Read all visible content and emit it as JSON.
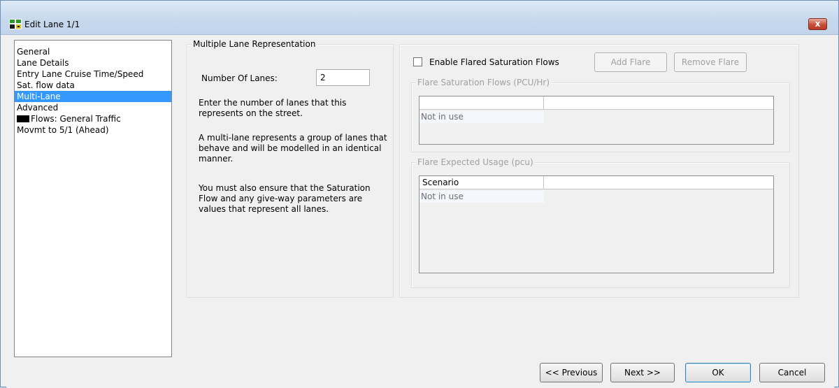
{
  "window": {
    "title": "Edit Lane 1/1",
    "close_label": "x"
  },
  "sidebar": {
    "items": [
      {
        "label": "General",
        "selected": false
      },
      {
        "label": "Lane Details",
        "selected": false
      },
      {
        "label": "Entry Lane Cruise Time/Speed",
        "selected": false
      },
      {
        "label": "Sat. flow data",
        "selected": false
      },
      {
        "label": "Multi-Lane",
        "selected": true
      },
      {
        "label": "Advanced",
        "selected": false
      },
      {
        "label": "Flows: General Traffic",
        "selected": false,
        "swatch": "#000000"
      },
      {
        "label": "Movmt to 5/1 (Ahead)",
        "selected": false
      }
    ]
  },
  "multi_lane": {
    "caption": "Multiple Lane Representation",
    "number_of_lanes_label": "Number Of Lanes:",
    "number_of_lanes_value": "2",
    "help_1": "Enter the number of lanes that this represents on the street.",
    "help_2": "A multi-lane represents a group of lanes that behave and will be modelled in an identical manner.",
    "help_3": "You must also ensure that the Saturation Flow and any give-way parameters are values that represent all lanes."
  },
  "flare": {
    "enable_label": "Enable Flared Saturation Flows",
    "enable_checked": false,
    "add_label": "Add Flare",
    "remove_label": "Remove Flare",
    "sat_flows": {
      "caption": "Flare Saturation Flows (PCU/Hr)",
      "columns": [
        "",
        ""
      ],
      "rows": [
        "Not in use"
      ]
    },
    "usage": {
      "caption": "Flare Expected Usage (pcu)",
      "columns": [
        "Scenario",
        ""
      ],
      "rows": [
        "Not in use"
      ]
    }
  },
  "footer": {
    "previous_label": "<< Previous",
    "next_label": "Next >>",
    "ok_label": "OK",
    "cancel_label": "Cancel"
  },
  "colors": {
    "selection": "#3399ff",
    "titlebar": "#c6d8ec",
    "close_button": "#c7503b"
  }
}
